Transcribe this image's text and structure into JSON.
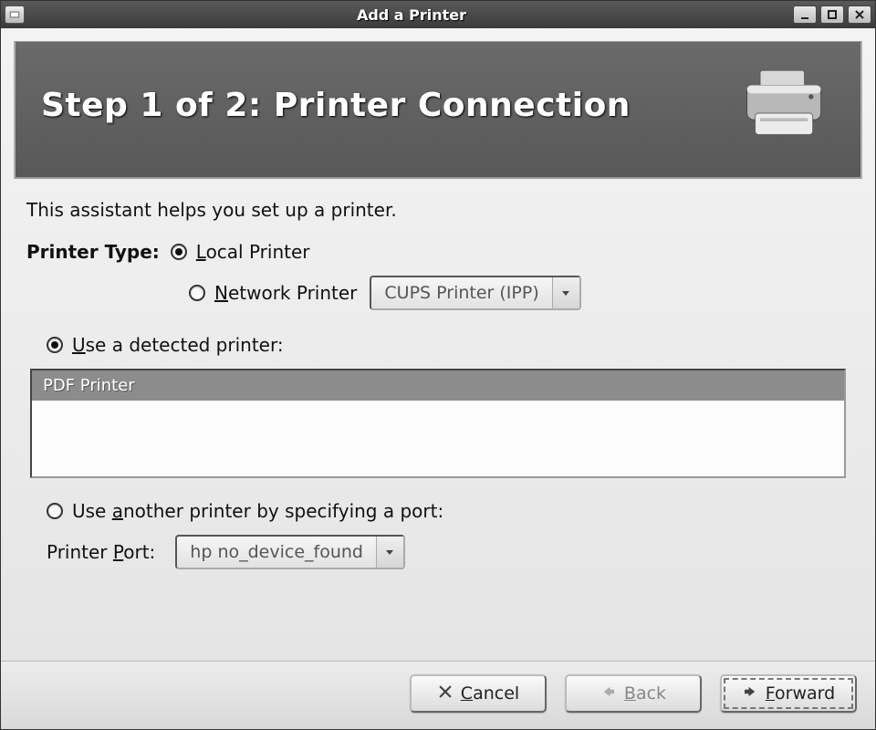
{
  "window": {
    "title": "Add a Printer"
  },
  "banner": {
    "heading": "Step 1 of 2: Printer Connection"
  },
  "form": {
    "intro": "This assistant helps you set up a printer.",
    "printer_type_label": "Printer Type:",
    "local_printer_l": "L",
    "local_printer_rest": "ocal Printer",
    "network_printer_n": "N",
    "network_printer_rest": "etwork Printer",
    "network_combo_value": "CUPS Printer (IPP)",
    "use_detected_u": "U",
    "use_detected_rest": "se a detected printer:",
    "detected_list_item": "PDF Printer",
    "use_another_pre": "Use ",
    "use_another_a": "a",
    "use_another_rest": "nother printer by specifying a port:",
    "port_label_pre": "Printer ",
    "port_label_p": "P",
    "port_label_rest": "ort:",
    "port_combo_value": "hp no_device_found"
  },
  "buttons": {
    "cancel_c": "C",
    "cancel_rest": "ancel",
    "back_b": "B",
    "back_rest": "ack",
    "forward_f": "F",
    "forward_rest": "orward"
  }
}
